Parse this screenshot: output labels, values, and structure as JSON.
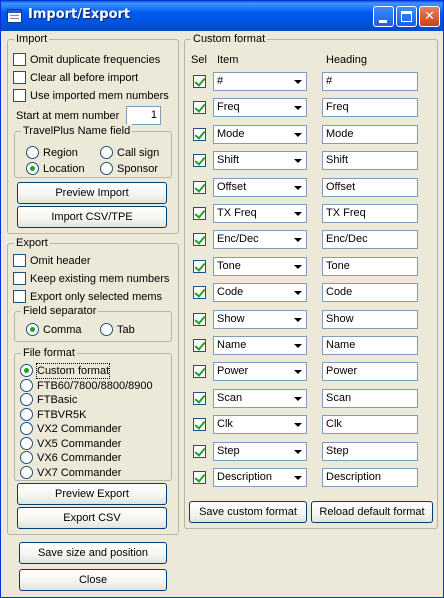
{
  "window": {
    "title": "Import/Export",
    "controls": [
      "minimize",
      "maximize",
      "close"
    ]
  },
  "import_group": {
    "label": "Import",
    "options": [
      {
        "label": "Omit duplicate frequencies",
        "checked": false
      },
      {
        "label": "Clear all before import",
        "checked": false
      },
      {
        "label": "Use imported mem numbers",
        "checked": false
      }
    ],
    "start_label": "Start at mem number",
    "start_value": "1",
    "travelplus": {
      "label": "TravelPlus Name field",
      "options": [
        {
          "label": "Region",
          "selected": false
        },
        {
          "label": "Call sign",
          "selected": false
        },
        {
          "label": "Location",
          "selected": true
        },
        {
          "label": "Sponsor",
          "selected": false
        }
      ]
    },
    "preview_button": "Preview Import",
    "import_button": "Import CSV/TPE"
  },
  "export_group": {
    "label": "Export",
    "options": [
      {
        "label": "Omit header",
        "checked": false
      },
      {
        "label": "Keep existing mem numbers",
        "checked": false
      },
      {
        "label": "Export only selected mems",
        "checked": false
      }
    ],
    "separator": {
      "label": "Field separator",
      "options": [
        {
          "label": "Comma",
          "selected": true
        },
        {
          "label": "Tab",
          "selected": false
        }
      ]
    },
    "file_format": {
      "label": "File format",
      "options": [
        {
          "label": "Custom format",
          "selected": true
        },
        {
          "label": "FTB60/7800/8800/8900",
          "selected": false
        },
        {
          "label": "FTBasic",
          "selected": false
        },
        {
          "label": "FTBVR5K",
          "selected": false
        },
        {
          "label": "VX2 Commander",
          "selected": false
        },
        {
          "label": "VX5 Commander",
          "selected": false
        },
        {
          "label": "VX6 Commander",
          "selected": false
        },
        {
          "label": "VX7 Commander",
          "selected": false
        }
      ]
    },
    "preview_button": "Preview Export",
    "export_button": "Export CSV"
  },
  "custom_format": {
    "label": "Custom format",
    "headers": {
      "sel": "Sel",
      "item": "Item",
      "heading": "Heading"
    },
    "rows": [
      {
        "selected": true,
        "item": "#",
        "heading": "#"
      },
      {
        "selected": true,
        "item": "Freq",
        "heading": "Freq"
      },
      {
        "selected": true,
        "item": "Mode",
        "heading": "Mode"
      },
      {
        "selected": true,
        "item": "Shift",
        "heading": "Shift"
      },
      {
        "selected": true,
        "item": "Offset",
        "heading": "Offset"
      },
      {
        "selected": true,
        "item": "TX Freq",
        "heading": "TX Freq"
      },
      {
        "selected": true,
        "item": "Enc/Dec",
        "heading": "Enc/Dec"
      },
      {
        "selected": true,
        "item": "Tone",
        "heading": "Tone"
      },
      {
        "selected": true,
        "item": "Code",
        "heading": "Code"
      },
      {
        "selected": true,
        "item": "Show",
        "heading": "Show"
      },
      {
        "selected": true,
        "item": "Name",
        "heading": "Name"
      },
      {
        "selected": true,
        "item": "Power",
        "heading": "Power"
      },
      {
        "selected": true,
        "item": "Scan",
        "heading": "Scan"
      },
      {
        "selected": true,
        "item": "Clk",
        "heading": "Clk"
      },
      {
        "selected": true,
        "item": "Step",
        "heading": "Step"
      },
      {
        "selected": true,
        "item": "Description",
        "heading": "Description"
      }
    ],
    "save_button": "Save custom format",
    "reload_button": "Reload default format"
  },
  "footer": {
    "save_size_button": "Save size and position",
    "close_button": "Close"
  }
}
